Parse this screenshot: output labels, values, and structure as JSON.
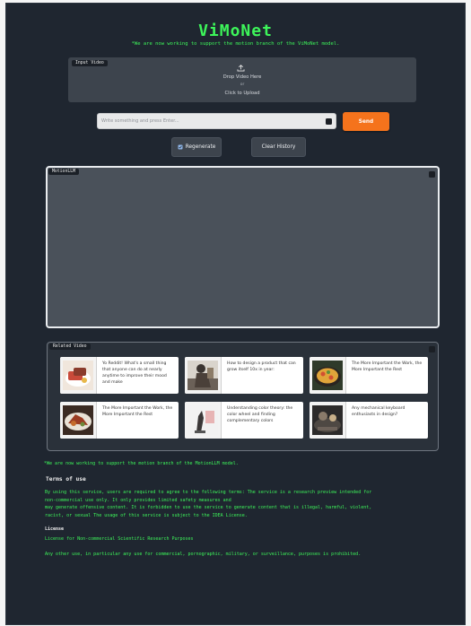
{
  "header": {
    "title": "ViMoNet",
    "subtitle": "*We are now working to support the motion branch of the ViMoNet model."
  },
  "upload": {
    "label": "Input Video",
    "icon": "upload-icon",
    "drop_text": "Drop Video Here",
    "or_text": "or",
    "click_text": "Click to Upload"
  },
  "chat_input": {
    "placeholder": "Write something and press Enter...",
    "value": ""
  },
  "buttons": {
    "send": "Send",
    "regenerate": "Regenerate",
    "clear_history": "Clear History"
  },
  "chatbot": {
    "label": "MotionLLM"
  },
  "related": {
    "label": "Related Video",
    "cards": [
      {
        "text": "Yo Reddit! What's a small thing that anyone can do at nearly anytime to improve their mood and make",
        "thumb": "food-plate"
      },
      {
        "text": "How to design a product that can grow itself 10x in year:",
        "thumb": "statue"
      },
      {
        "text": "The More Important the Work, the More Important the Rest",
        "thumb": "paella"
      },
      {
        "text": "The More Important the Work, the More Important the Rest",
        "thumb": "food-plate-2"
      },
      {
        "text": "Understanding color theory: the color wheel and finding complementary colors",
        "thumb": "sculpture"
      },
      {
        "text": "Any mechanical keyboard enthusiasts in design?",
        "thumb": "cafe"
      }
    ]
  },
  "footer": {
    "note": "*We are now working to support the motion branch of the MotionLLM model.",
    "terms_title": "Terms of use",
    "terms_lines": [
      "By using this service, users are required to agree to the following terms: The service is a research preview intended for",
      "non-commercial use only. It only provides limited safety measures and",
      "may generate offensive content. It is forbidden to use the service to generate content that is illegal, harmful, violent,",
      "racist, or sexual The usage of this service is subject to the IDEA License."
    ],
    "license_title": "License",
    "license_text": "License for Non-commercial Scientific Research Purposes",
    "other_use": "Any other use, in particular any use for commercial, pornographic, military, or surveillance, purposes is prohibited."
  }
}
